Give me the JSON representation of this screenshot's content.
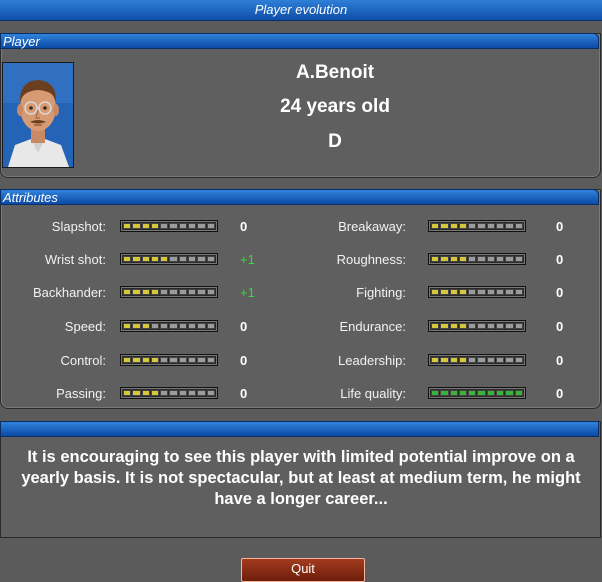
{
  "window": {
    "title": "Player evolution"
  },
  "player_section": {
    "header": "Player",
    "name": "A.Benoit",
    "age": "24 years old",
    "rating": "D"
  },
  "attributes_section": {
    "header": "Attributes",
    "left": [
      {
        "label": "Slapshot:",
        "level": 4,
        "change": "0"
      },
      {
        "label": "Wrist shot:",
        "level": 5,
        "change": "+1"
      },
      {
        "label": "Backhander:",
        "level": 4,
        "change": "+1"
      },
      {
        "label": "Speed:",
        "level": 3,
        "change": "0"
      },
      {
        "label": "Control:",
        "level": 4,
        "change": "0"
      },
      {
        "label": "Passing:",
        "level": 4,
        "change": "0"
      }
    ],
    "right": [
      {
        "label": "Breakaway:",
        "level": 4,
        "change": "0"
      },
      {
        "label": "Roughness:",
        "level": 4,
        "change": "0"
      },
      {
        "label": "Fighting:",
        "level": 4,
        "change": "0"
      },
      {
        "label": "Endurance:",
        "level": 4,
        "change": "0"
      },
      {
        "label": "Leadership:",
        "level": 4,
        "change": "0"
      },
      {
        "label": "Life quality:",
        "level": 10,
        "change": "0",
        "color": "green"
      }
    ]
  },
  "message": "It is encouraging to see this player with limited potential improve on a yearly basis. It is not spectacular, but at least at medium term, he might have a longer career...",
  "buttons": {
    "quit": "Quit"
  },
  "colors": {
    "header_blue": "#0e4ea8",
    "bar_on": "#d6c83a",
    "bar_green": "#3bb33b",
    "positive_change": "#33dd33",
    "quit_red": "#8a2a14"
  }
}
